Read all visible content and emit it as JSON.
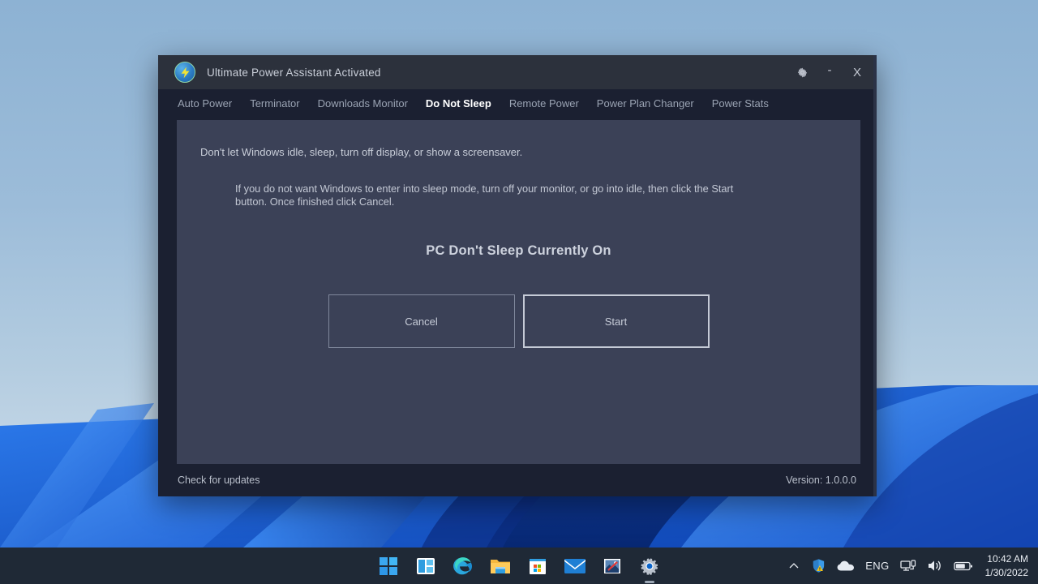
{
  "window": {
    "title": "Ultimate Power Assistant Activated",
    "app_icon": "lightning-bolt-icon",
    "controls": {
      "settings": "gear-icon",
      "minimize": "-",
      "close": "X"
    }
  },
  "tabs": [
    {
      "label": "Auto Power",
      "active": false
    },
    {
      "label": "Terminator",
      "active": false
    },
    {
      "label": "Downloads Monitor",
      "active": false
    },
    {
      "label": "Do Not Sleep",
      "active": true
    },
    {
      "label": "Remote Power",
      "active": false
    },
    {
      "label": "Power Plan Changer",
      "active": false
    },
    {
      "label": "Power Stats",
      "active": false
    }
  ],
  "content": {
    "lead_text": "Don't let Windows idle, sleep, turn off display, or show a screensaver.",
    "sub_text": "If you do not want Windows to enter into sleep mode, turn off your monitor, or go into idle, then click the Start button. Once finished click Cancel.",
    "status_heading": "PC Don't Sleep Currently On",
    "cancel_label": "Cancel",
    "start_label": "Start"
  },
  "footer": {
    "check_updates": "Check for updates",
    "version": "Version: 1.0.0.0"
  },
  "taskbar": {
    "icons": [
      "start-icon",
      "widgets-icon",
      "edge-icon",
      "file-explorer-icon",
      "microsoft-store-icon",
      "mail-icon",
      "photos-icon",
      "settings-gear-icon"
    ],
    "tray": {
      "overflow": "chevron-up-icon",
      "security": "security-shield-warning-icon",
      "onedrive": "cloud-icon",
      "language": "ENG",
      "network": "network-icon",
      "volume": "speaker-icon",
      "battery": "battery-icon",
      "time": "10:42 AM",
      "date": "1/30/2022"
    }
  },
  "colors": {
    "window_frame": "#1b2031",
    "titlebar": "#2c313c",
    "panel": "#3b4157",
    "accent_text": "#ffffff",
    "taskbar": "#1f2936"
  }
}
